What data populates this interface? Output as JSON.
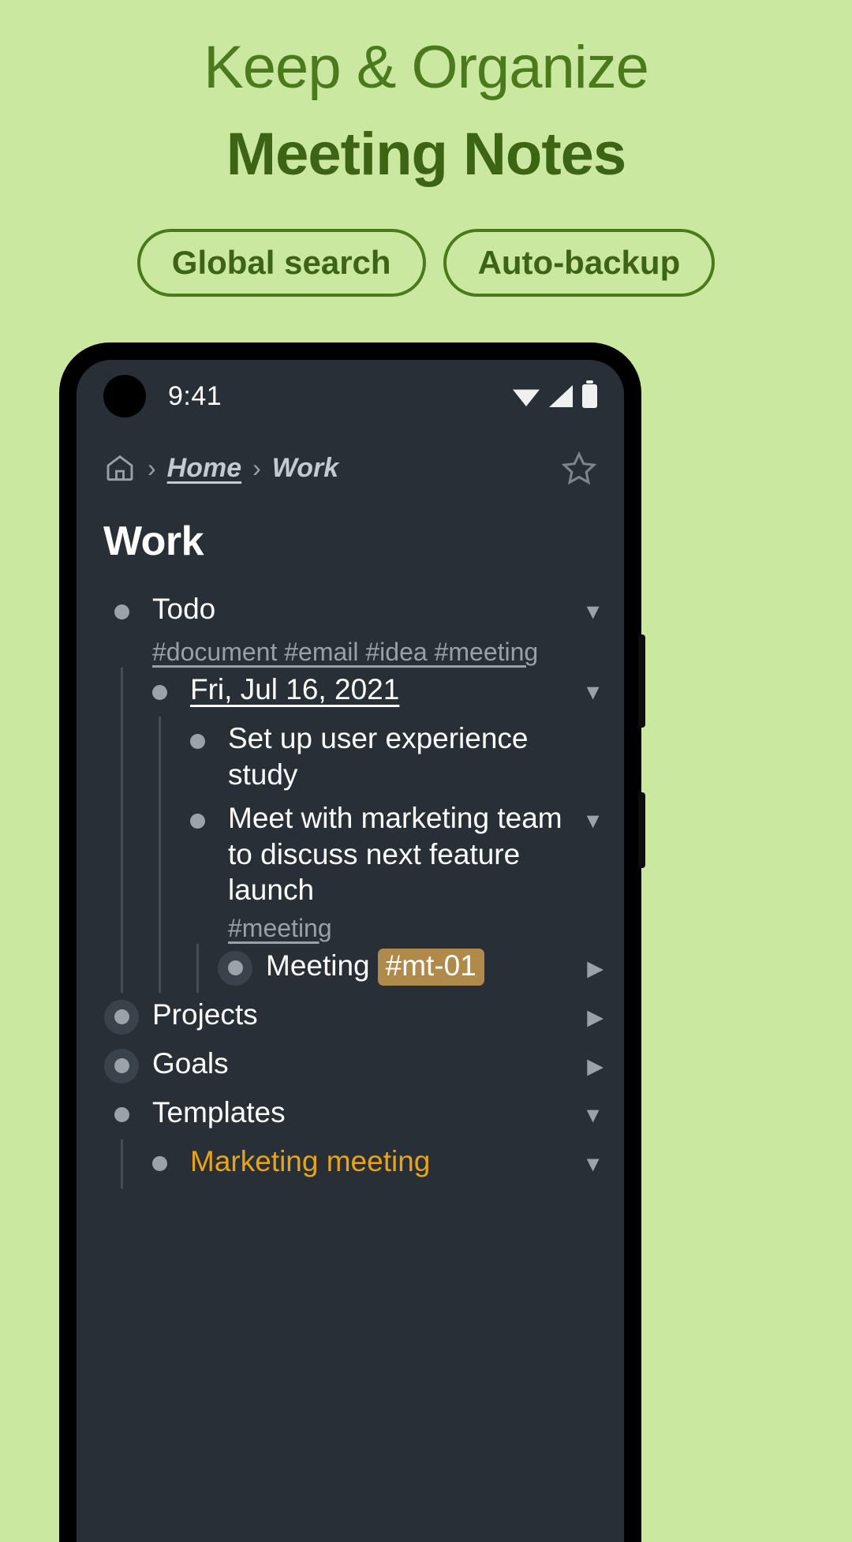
{
  "promo": {
    "line1": "Keep & Organize",
    "line2": "Meeting Notes",
    "pills": [
      {
        "label": "Global search"
      },
      {
        "label": "Auto-backup"
      }
    ],
    "accent_green": "#4a7a1c",
    "background": "#cbe8a0"
  },
  "phone": {
    "statusbar": {
      "time": "9:41",
      "icons": [
        "wifi-icon",
        "signal-icon",
        "battery-icon"
      ]
    },
    "breadcrumb": {
      "home_icon": "home-icon",
      "separator": "›",
      "items": [
        {
          "label": "Home",
          "link": true
        },
        {
          "label": "Work",
          "link": false
        }
      ],
      "favorite_icon": "star-icon"
    },
    "page_title": "Work",
    "tree": [
      {
        "label": "Todo",
        "tags": "#document #email #idea #meeting",
        "toggle": "▼",
        "bullet": "plain",
        "children": [
          {
            "label": "Fri, Jul 16, 2021",
            "underline": true,
            "toggle": "▼",
            "bullet": "plain",
            "children": [
              {
                "label": "Set up user experience study",
                "toggle": "",
                "bullet": "plain"
              },
              {
                "label": "Meet with marketing team to discuss next feature launch",
                "tags": "#meeting",
                "toggle": "▼",
                "bullet": "plain",
                "children": [
                  {
                    "label": "Meeting",
                    "badge": "#mt-01",
                    "toggle": "▶",
                    "bullet": "ringed"
                  }
                ]
              }
            ]
          }
        ]
      },
      {
        "label": "Projects",
        "toggle": "▶",
        "bullet": "ringed"
      },
      {
        "label": "Goals",
        "toggle": "▶",
        "bullet": "ringed"
      },
      {
        "label": "Templates",
        "toggle": "▼",
        "bullet": "plain",
        "children": [
          {
            "label": "Marketing meeting",
            "amber": true,
            "toggle": "▼",
            "bullet": "plain"
          }
        ]
      }
    ],
    "colors": {
      "screen_bg": "#282f36",
      "badge_bg": "#b08a4a",
      "amber_text": "#e8a317",
      "bullet": "#9aa2aa"
    }
  }
}
